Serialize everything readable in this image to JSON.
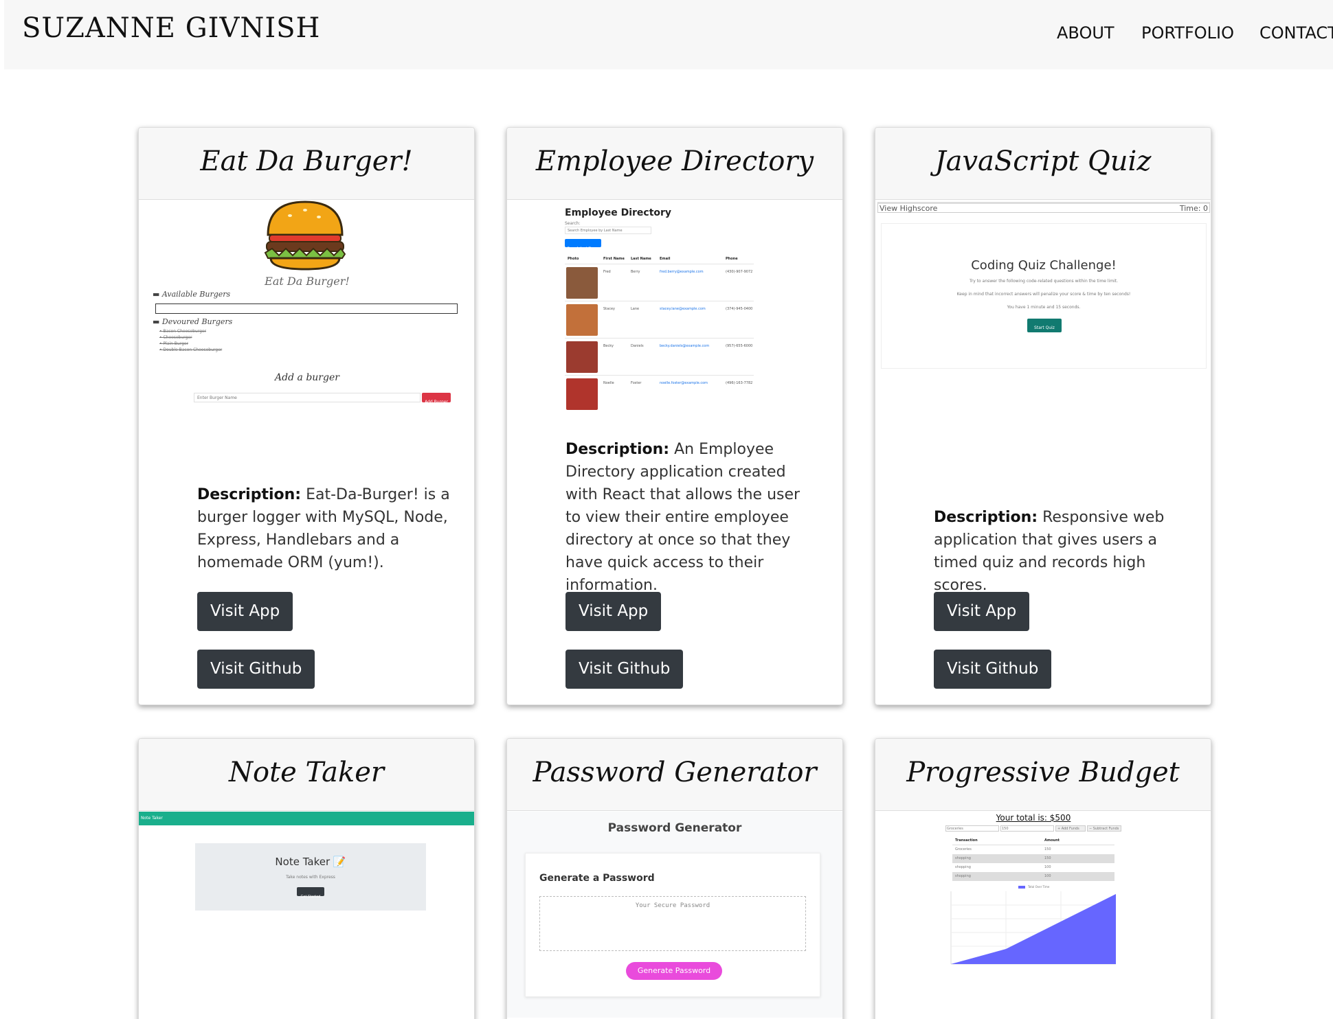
{
  "header": {
    "brand": "SUZANNE GIVNISH",
    "nav": [
      "ABOUT",
      "PORTFOLIO",
      "CONTACT"
    ]
  },
  "desc_label": "Description:",
  "buttons": {
    "app": "Visit App",
    "github": "Visit Github"
  },
  "projects": [
    {
      "title": "Eat Da Burger!",
      "description": "Eat-Da-Burger! is a burger logger with MySQL, Node, Express, Handlebars and a homemade ORM (yum!).",
      "preview": {
        "heading": "Eat Da Burger!",
        "available": "Available Burgers",
        "devoured": "Devoured Burgers",
        "devoured_items": [
          "Bacon Cheeseburger",
          "Cheeseburger",
          "Plain Burger",
          "Double Bacon Cheeseburger"
        ],
        "add_heading": "Add a burger",
        "input_placeholder": "Enter Burger Name",
        "add_button": "Add Burger"
      }
    },
    {
      "title": "Employee Directory",
      "description": "An Employee Directory application created with React that allows the user to view their entire employee directory at once so that they have quick access to their information.",
      "preview": {
        "heading": "Employee Directory",
        "search_label": "Search:",
        "search_placeholder": "Search Employee by Last Name",
        "search_button": "Search Last Name",
        "columns": [
          "Photo",
          "First Name",
          "Last Name",
          "Email",
          "Phone"
        ],
        "rows": [
          {
            "first": "Fred",
            "last": "Berry",
            "email": "fred.berry@example.com",
            "phone": "(430)-907-9072",
            "color": "#8a5a3c"
          },
          {
            "first": "Stacey",
            "last": "Lane",
            "email": "stacey.lane@example.com",
            "phone": "(374)-945-0400",
            "color": "#c2703a"
          },
          {
            "first": "Becky",
            "last": "Daniels",
            "email": "becky.daniels@example.com",
            "phone": "(957)-655-6000",
            "color": "#9b3b2f"
          },
          {
            "first": "Noelle",
            "last": "Foster",
            "email": "noelle.foster@example.com",
            "phone": "(496)-163-7782",
            "color": "#b0342c"
          }
        ]
      }
    },
    {
      "title": "JavaScript Quiz",
      "description": "Responsive web application that gives users a timed quiz and records high scores.",
      "preview": {
        "view_highscore": "View Highscore",
        "time": "Time: 0",
        "heading": "Coding Quiz Challenge!",
        "line1": "Try to answer the following code-related questions within the time limit.",
        "line2": "Keep in mind that incorrect answers will penalize your score & time by ten seconds!",
        "line3": "You have 1 minute and 15 seconds.",
        "start_button": "Start Quiz"
      }
    },
    {
      "title": "Note Taker",
      "preview": {
        "nav_label": "Note Taker",
        "heading": "Note Taker 📝",
        "subtitle": "Take notes with Express",
        "button": "Get Started"
      }
    },
    {
      "title": "Password Generator",
      "preview": {
        "heading": "Password Generator",
        "card_title": "Generate a Password",
        "placeholder": "Your Secure Password",
        "button": "Generate Password"
      }
    },
    {
      "title": "Progressive Budget",
      "preview": {
        "total": "Your total is: $500",
        "name_value": "Groceries",
        "amount_value": "150",
        "add_button": "+ Add Funds",
        "subtract_button": "− Subtract Funds",
        "columns": [
          "Transaction",
          "Amount"
        ],
        "rows": [
          {
            "name": "Groceries",
            "amount": "150"
          },
          {
            "name": "shopping",
            "amount": "150"
          },
          {
            "name": "shopping",
            "amount": "100"
          },
          {
            "name": "shopping",
            "amount": "100"
          }
        ],
        "legend": "Total Over Time",
        "chart_color": "#6666ff"
      }
    }
  ]
}
